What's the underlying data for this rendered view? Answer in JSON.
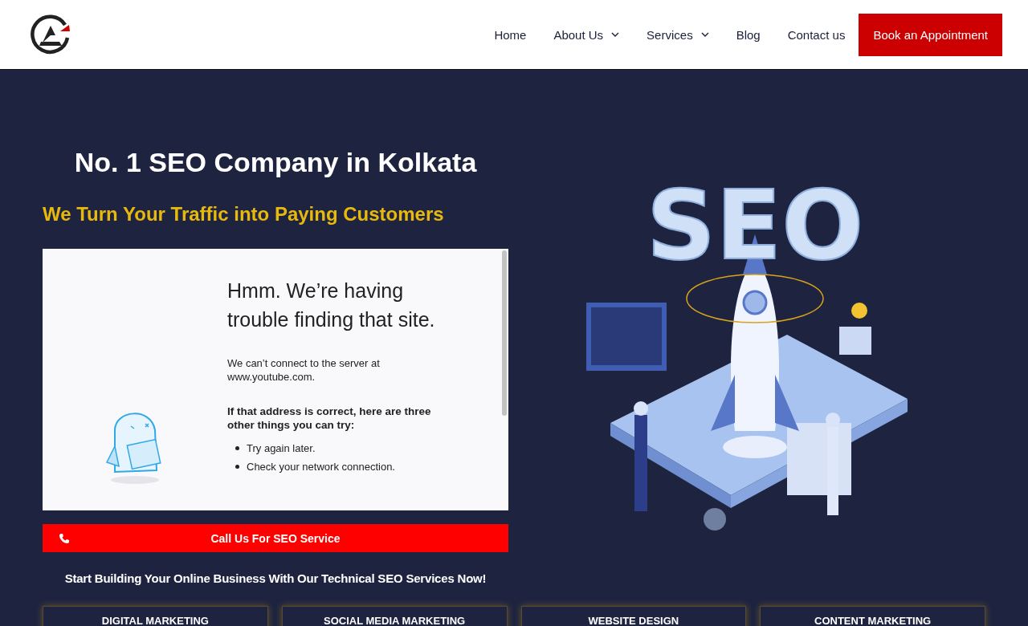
{
  "nav": {
    "items": [
      {
        "label": "Home",
        "dropdown": false
      },
      {
        "label": "About Us",
        "dropdown": true
      },
      {
        "label": "Services",
        "dropdown": true
      },
      {
        "label": "Blog",
        "dropdown": false
      },
      {
        "label": "Contact us",
        "dropdown": false
      }
    ],
    "cta": "Book an Appointment"
  },
  "hero": {
    "title": "No. 1 SEO Company in Kolkata",
    "subtitle": "We Turn Your Traffic into Paying Customers",
    "embed": {
      "heading": "Hmm. We’re having trouble finding that site.",
      "message": "We can’t connect to the server at www.youtube.com.",
      "tips_heading": "If that address is correct, here are three other things you can try:",
      "tips": [
        "Try again later.",
        "Check your network connection."
      ]
    },
    "call_button": "Call Us For SEO Service",
    "tagline": "Start Building Your Online Business With Our Technical SEO Services Now!",
    "illustration": {
      "label": "SEO"
    }
  },
  "services": [
    "DIGITAL MARKETING",
    "SOCIAL MEDIA MARKETING",
    "WEBSITE DESIGN",
    "CONTENT MARKETING"
  ]
}
